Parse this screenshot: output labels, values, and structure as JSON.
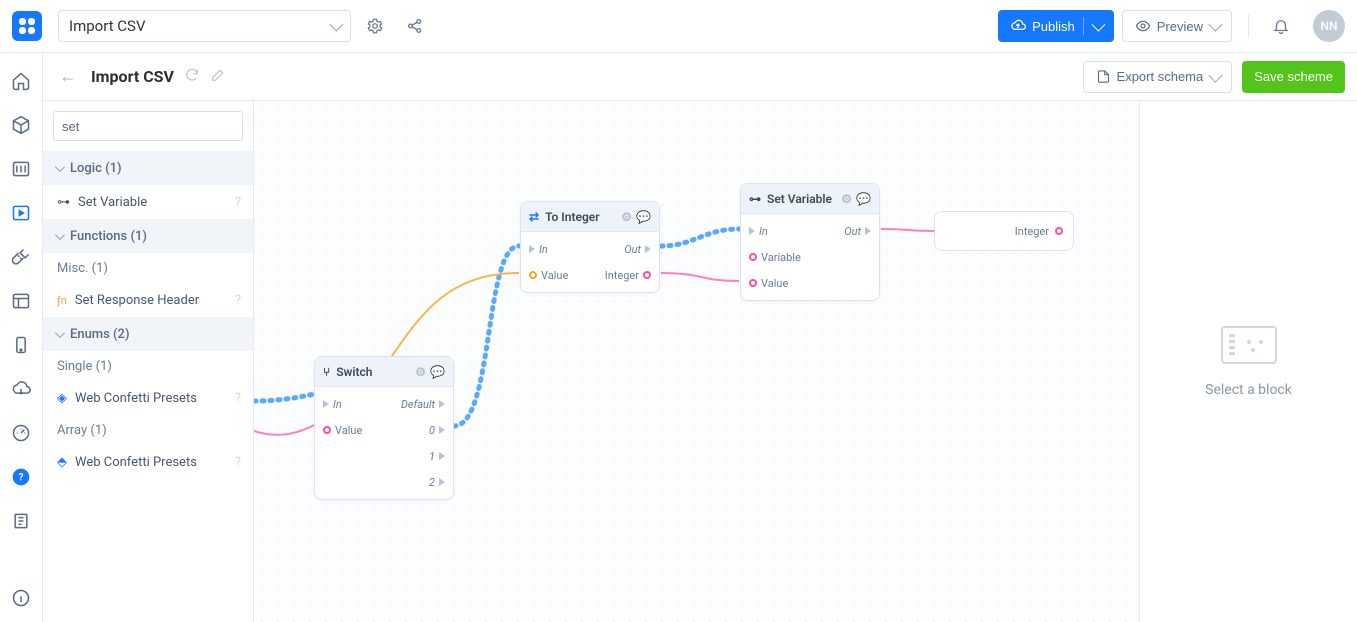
{
  "topbar": {
    "project_name": "Import CSV",
    "publish_label": "Publish",
    "preview_label": "Preview",
    "avatar_initials": "NN"
  },
  "subheader": {
    "title": "Import CSV",
    "export_label": "Export schema",
    "save_label": "Save scheme"
  },
  "palette": {
    "search_value": "set",
    "categories": [
      {
        "label": "Logic (1)",
        "items": [
          {
            "label": "Set Variable",
            "icon": "link-icon"
          }
        ]
      },
      {
        "label": "Functions (1)",
        "subcats": [
          {
            "label": "Misc. (1)",
            "items": [
              {
                "label": "Set Response Header",
                "icon": "fn-icon"
              }
            ]
          }
        ]
      },
      {
        "label": "Enums (2)",
        "subcats": [
          {
            "label": "Single (1)",
            "items": [
              {
                "label": "Web Confetti Presets",
                "icon": "diamond-icon"
              }
            ]
          },
          {
            "label": "Array (1)",
            "items": [
              {
                "label": "Web Confetti Presets",
                "icon": "diamond-multi-icon"
              }
            ]
          }
        ]
      }
    ]
  },
  "canvas": {
    "nodes": {
      "switch": {
        "title": "Switch",
        "rows": [
          {
            "left": "In",
            "right": "Default",
            "left_port": "tri",
            "right_port": "tri",
            "right_italic": true
          },
          {
            "left": "Value",
            "right": "0",
            "left_port": "pink",
            "right_port": "tri",
            "right_italic": true
          },
          {
            "left": "",
            "right": "1",
            "right_port": "tri",
            "right_italic": true
          },
          {
            "left": "",
            "right": "2",
            "right_port": "tri",
            "right_italic": true
          }
        ]
      },
      "to_integer": {
        "title": "To Integer",
        "rows": [
          {
            "left": "In",
            "right": "Out",
            "left_port": "tri",
            "right_port": "tri",
            "left_italic": true,
            "right_italic": true
          },
          {
            "left": "Value",
            "right": "Integer",
            "left_port": "yellow",
            "right_port": "pink"
          }
        ]
      },
      "set_variable": {
        "title": "Set Variable",
        "rows": [
          {
            "left": "In",
            "right": "Out",
            "left_port": "tri",
            "right_port": "tri",
            "left_italic": true,
            "right_italic": true
          },
          {
            "left": "Variable",
            "right": "",
            "left_port": "pink"
          },
          {
            "left": "Value",
            "right": "",
            "left_port": "pink"
          }
        ]
      },
      "result": {
        "label": "Integer"
      }
    }
  },
  "inspector": {
    "placeholder": "Select a block"
  }
}
